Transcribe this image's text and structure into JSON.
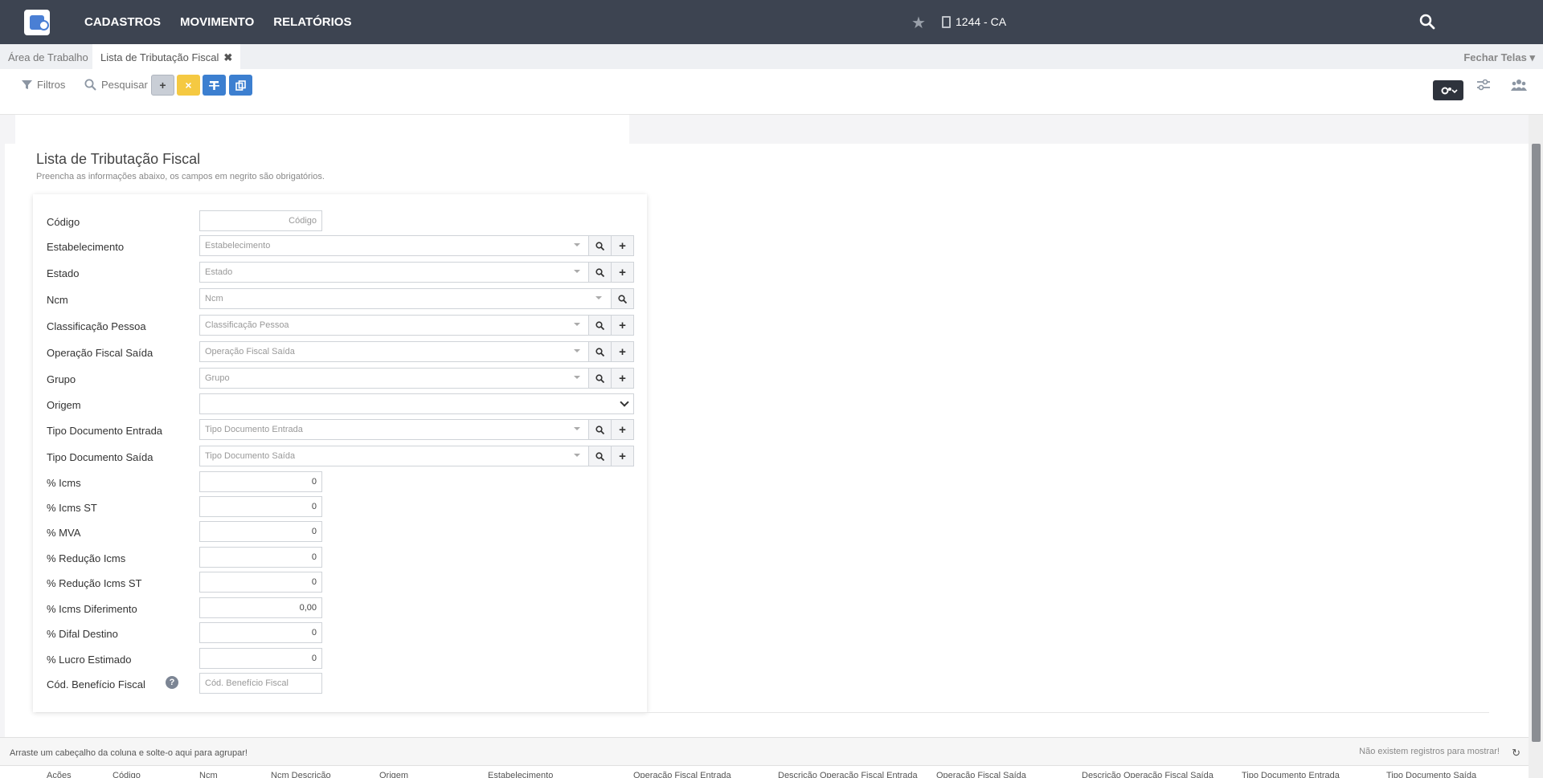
{
  "nav": {
    "menu": [
      "CADASTROS",
      "MOVIMENTO",
      "RELATÓRIOS"
    ],
    "store_label": "1244 - CA"
  },
  "tabs": {
    "items": [
      "Área de Trabalho",
      "Lista de Tributação Fiscal"
    ],
    "close_symbol": "✖",
    "fechar_label": "Fechar Telas"
  },
  "toolbar": {
    "filtros_label": "Filtros",
    "pesquisar_label": "Pesquisar",
    "add_symbol": "+",
    "clear_symbol": "×"
  },
  "page": {
    "title": "Lista de Tributação Fiscal",
    "subtitle": "Preencha as informações abaixo, os campos em negrito são obrigatórios."
  },
  "form": {
    "codigo": {
      "label": "Código",
      "placeholder": "Código"
    },
    "estabelecimento": {
      "label": "Estabelecimento",
      "placeholder": "Estabelecimento"
    },
    "estado": {
      "label": "Estado",
      "placeholder": "Estado"
    },
    "ncm": {
      "label": "Ncm",
      "placeholder": "Ncm"
    },
    "classificacao": {
      "label": "Classificação Pessoa",
      "placeholder": "Classificação Pessoa"
    },
    "operacao_saida": {
      "label": "Operação Fiscal Saída",
      "placeholder": "Operação Fiscal Saída"
    },
    "grupo": {
      "label": "Grupo",
      "placeholder": "Grupo"
    },
    "origem": {
      "label": "Origem",
      "value": ""
    },
    "tipo_doc_entrada": {
      "label": "Tipo Documento Entrada",
      "placeholder": "Tipo Documento Entrada"
    },
    "tipo_doc_saida": {
      "label": "Tipo Documento Saída",
      "placeholder": "Tipo Documento Saída"
    },
    "icms": {
      "label": "% Icms",
      "value": "0"
    },
    "icms_st": {
      "label": "% Icms ST",
      "value": "0"
    },
    "mva": {
      "label": "% MVA",
      "value": "0"
    },
    "reducao_icms": {
      "label": "% Redução Icms",
      "value": "0"
    },
    "reducao_icms_st": {
      "label": "% Redução Icms ST",
      "value": "0"
    },
    "icms_diferimento": {
      "label": "% Icms Diferimento",
      "value": "0,00"
    },
    "difal_destino": {
      "label": "% Difal Destino",
      "value": "0"
    },
    "lucro_estimado": {
      "label": "% Lucro Estimado",
      "value": "0"
    },
    "cod_beneficio": {
      "label": "Cód. Benefício Fiscal",
      "placeholder": "Cód. Benefício Fiscal",
      "help": "?"
    }
  },
  "grid": {
    "group_hint": "Arraste um cabeçalho da coluna e solte-o aqui para agrupar!",
    "empty_text": "Não existem registros para mostrar!",
    "refresh_symbol": "↻",
    "columns": [
      "Ações",
      "Código",
      "Ncm",
      "Ncm Descrição",
      "Origem",
      "Estabelecimento",
      "Operação Fiscal Entrada",
      "Descrição Operação Fiscal Entrada",
      "Operação Fiscal Saída",
      "Descrição Operação Fiscal Saída",
      "Tipo Documento Entrada",
      "Tipo Documento Saída"
    ]
  },
  "colors": {
    "topbar": "#3d4451",
    "accent_blue": "#3c7fd0",
    "accent_yellow": "#f5c942"
  }
}
